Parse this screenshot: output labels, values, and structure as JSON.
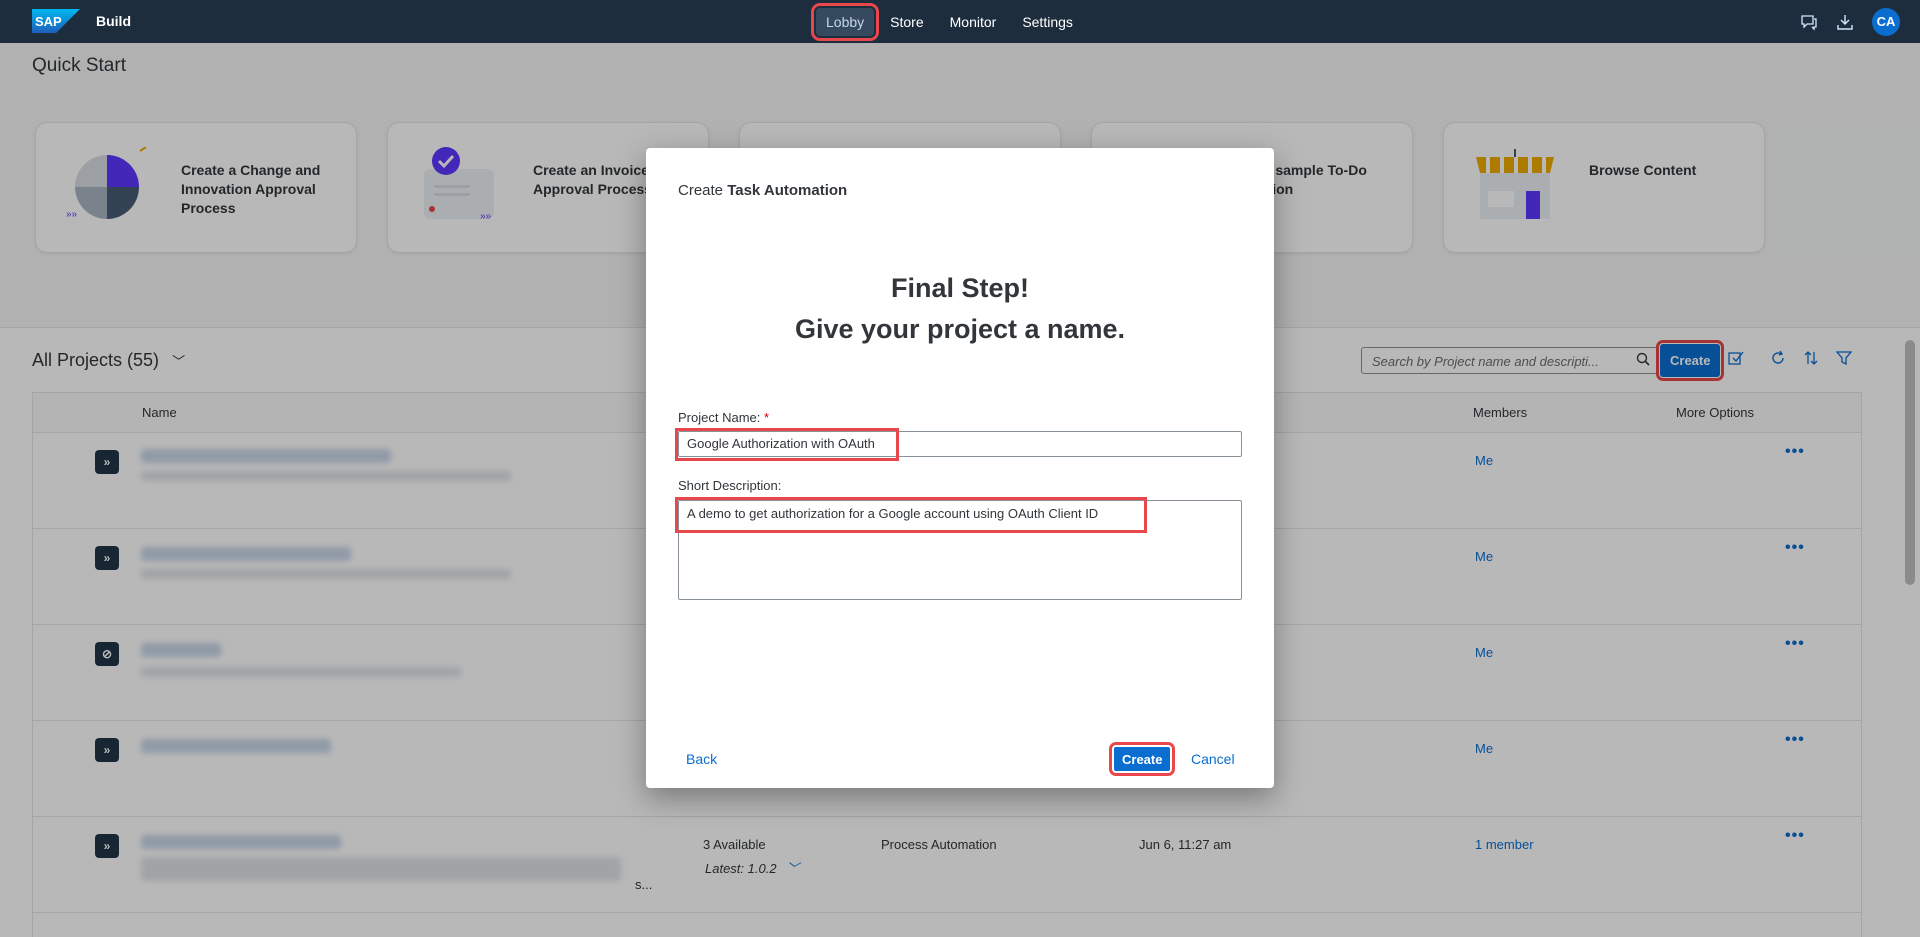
{
  "shell": {
    "title": "Build",
    "nav": [
      "Lobby",
      "Store",
      "Monitor",
      "Settings"
    ],
    "avatar_initials": "CA",
    "icons": [
      "feedback-icon",
      "download-icon"
    ]
  },
  "quickstart": {
    "title": "Quick Start",
    "cards": [
      "Create a Change and Innovation Approval Process",
      "Create an Invoice Approval Process",
      "",
      "e a sample To-Do cation",
      "Browse Content"
    ]
  },
  "projects": {
    "title": "All Projects (55)",
    "search_placeholder": "Search by Project name and descripti...",
    "create_label": "Create",
    "columns": {
      "name": "Name",
      "members": "Members",
      "more": "More Options"
    },
    "rows": [
      {
        "icon": "»",
        "member": "Me"
      },
      {
        "icon": "»",
        "member": "Me"
      },
      {
        "icon": "⊘",
        "member": "Me"
      },
      {
        "icon": "»",
        "member": "Me"
      },
      {
        "icon": "»",
        "member": "1 member",
        "versions": "3 Available",
        "latest": "Latest: 1.0.2",
        "type": "Process Automation",
        "date": "Jun 6, 11:27 am",
        "ellipsis": "s..."
      }
    ]
  },
  "dialog": {
    "header_prefix": "Create",
    "header_type": "Task Automation",
    "title_line1": "Final Step!",
    "title_line2": "Give your project a name.",
    "name_label": "Project Name:",
    "name_required": "*",
    "name_value": "Google Authorization with OAuth",
    "desc_label": "Short Description:",
    "desc_value": "A demo to get authorization for a Google account using OAuth Client ID",
    "back": "Back",
    "create": "Create",
    "cancel": "Cancel"
  },
  "colors": {
    "shell": "#1d2d3e",
    "accent": "#0a6ed1",
    "highlight": "#e8474c"
  }
}
